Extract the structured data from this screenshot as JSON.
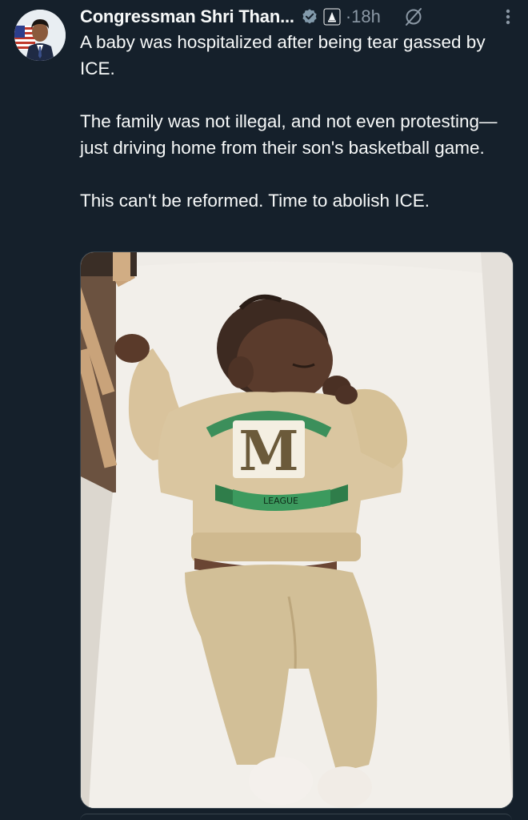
{
  "post": {
    "author_name": "Congressman Shri Than...",
    "timestamp": "18h",
    "separator": "·",
    "paragraphs": [
      "A baby was hospitalized after being tear gassed by ICE.",
      "The family was not illegal, and not even protesting—just driving home from their son's basketball game.",
      "This can't be reformed. Time to abolish ICE."
    ]
  },
  "media": {
    "shirt_text": "M",
    "banner_text": "LEAGUE"
  },
  "icons": {
    "verified": "verified-badge-icon",
    "government": "government-affiliation-icon",
    "grok": "grok-icon",
    "more": "more-options-icon"
  },
  "colors": {
    "background": "#15202b",
    "text": "#f7f9f9",
    "secondary_text": "#8b98a5",
    "verified_badge": "#829aab"
  }
}
